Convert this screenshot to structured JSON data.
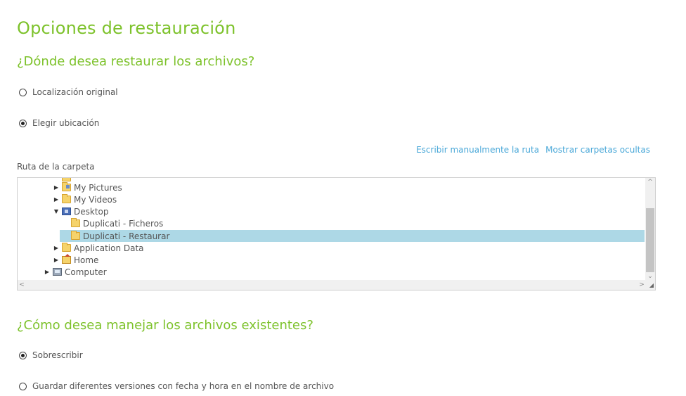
{
  "page": {
    "title": "Opciones de restauración"
  },
  "location": {
    "question": "¿Dónde desea restaurar los archivos?",
    "options": [
      {
        "label": "Localización original",
        "checked": false
      },
      {
        "label": "Elegir ubicación",
        "checked": true
      }
    ]
  },
  "links": {
    "manual_path": "Escribir manualmente la ruta",
    "show_hidden": "Mostrar carpetas ocultas"
  },
  "folder_path_label": "Ruta de la carpeta",
  "tree": {
    "nodes": [
      {
        "label": "My Pictures",
        "icon": "pictures-folder-icon",
        "expander": "collapsed"
      },
      {
        "label": "My Videos",
        "icon": "folder-icon",
        "expander": "collapsed"
      },
      {
        "label": "Desktop",
        "icon": "desktop-icon",
        "expander": "expanded"
      },
      {
        "label": "Duplicati - Ficheros",
        "icon": "folder-icon",
        "expander": "none"
      },
      {
        "label": "Duplicati - Restaurar",
        "icon": "folder-icon",
        "expander": "none",
        "selected": true
      },
      {
        "label": "Application Data",
        "icon": "folder-icon",
        "expander": "collapsed"
      },
      {
        "label": "Home",
        "icon": "home-icon",
        "expander": "collapsed"
      },
      {
        "label": "Computer",
        "icon": "computer-icon",
        "expander": "collapsed"
      }
    ]
  },
  "existing": {
    "question": "¿Cómo desea manejar los archivos existentes?",
    "options": [
      {
        "label": "Sobrescribir",
        "checked": true
      },
      {
        "label": "Guardar diferentes versiones con fecha y hora en el nombre de archivo",
        "checked": false
      }
    ]
  },
  "colors": {
    "heading": "#7dc22b",
    "link": "#4aa8d8",
    "selection": "#add8e6"
  }
}
